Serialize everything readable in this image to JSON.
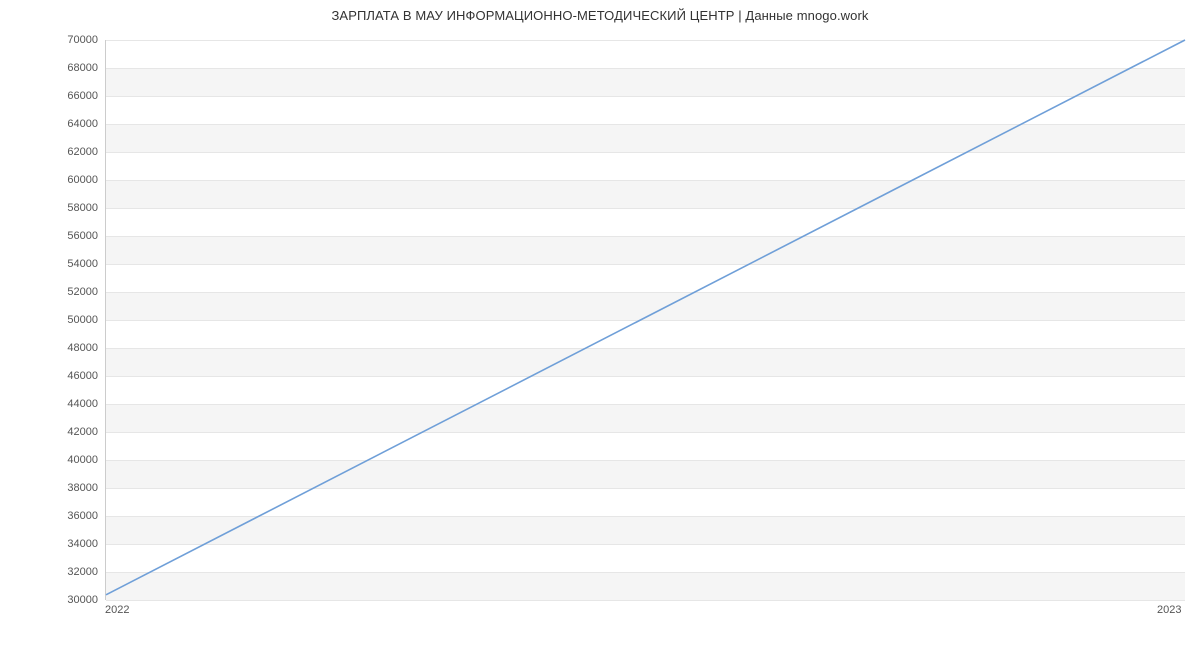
{
  "chart_data": {
    "type": "line",
    "title": "ЗАРПЛАТА В МАУ ИНФОРМАЦИОННО-МЕТОДИЧЕСКИЙ ЦЕНТР | Данные mnogo.work",
    "x": [
      2022,
      2023
    ],
    "values": [
      30300,
      70000
    ],
    "xlabel": "",
    "ylabel": "",
    "xlim": [
      2022,
      2023
    ],
    "ylim": [
      30000,
      70000
    ],
    "y_ticks": [
      30000,
      32000,
      34000,
      36000,
      38000,
      40000,
      42000,
      44000,
      46000,
      48000,
      50000,
      52000,
      54000,
      56000,
      58000,
      60000,
      62000,
      64000,
      66000,
      68000,
      70000
    ],
    "x_ticks": [
      2022,
      2023
    ],
    "line_color": "#6f9fd8",
    "grid": true
  }
}
